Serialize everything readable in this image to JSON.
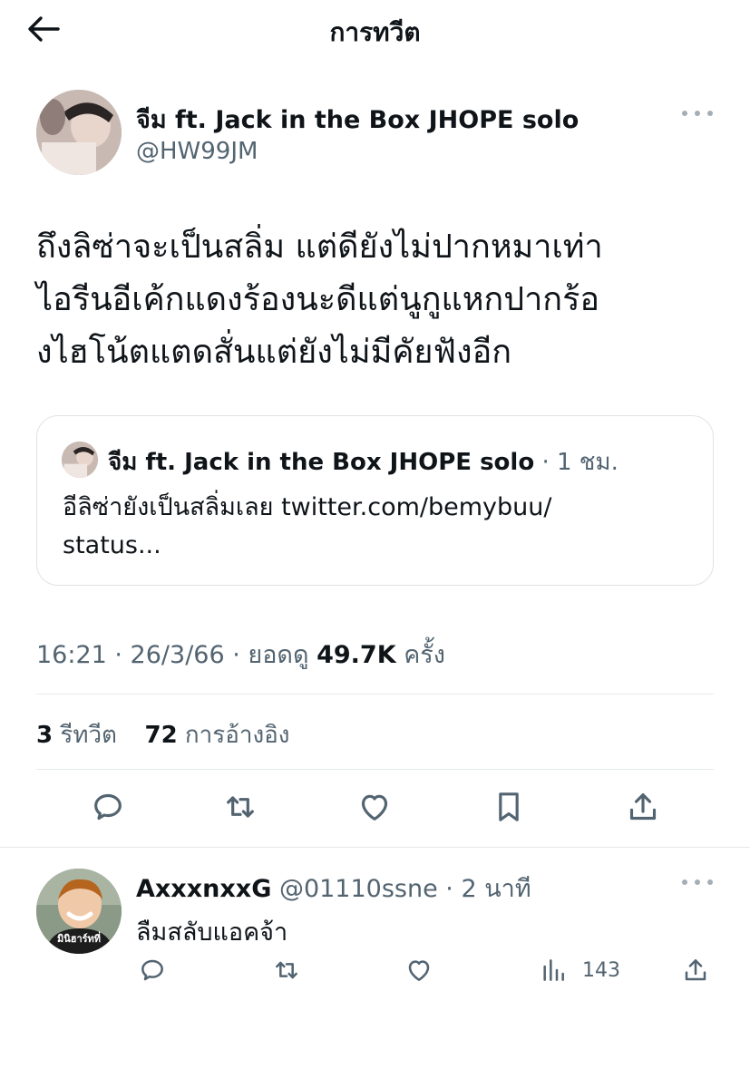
{
  "header": {
    "title": "การทวีต",
    "back_icon": "arrow-left-icon"
  },
  "tweet": {
    "author_name": "จีม ft. Jack in the Box JHOPE solo",
    "handle": "@HW99JM",
    "text_lines": [
      "ถึงลิซ่าจะเป็นสลิ่ม แต่ดียังไม่ปากหมาเท่า",
      "ไอรีนอีเค้กแดงร้องนะดีแต่นูกูแหกปากร้อ",
      "งไฮโน้ตแตดสั่นแต่ยังไม่มีคัยฟังอีก"
    ],
    "quote": {
      "author_name": "จีม ft. Jack in the Box JHOPE solo",
      "time": " · 1 ชม.",
      "text_line1": "อีลิซ่ายังเป็นสลิ่มเลย twitter.com/bemybuu/",
      "text_line2": "status..."
    },
    "timestamp": "16:21 · 26/3/66 · ยอดดู ",
    "views": "49.7K",
    "views_unit": " ครั้ง",
    "retweets": "3",
    "retweets_label": " รีทวีต",
    "quotes": "72",
    "quotes_label": " การอ้างอิง"
  },
  "reply": {
    "author_name": "AxxxnxxG",
    "meta": " @01110ssne · 2 นาที",
    "text": "ลืมสลับแอคจ้า",
    "avatar_caption": "มินิฮาร์ทที่",
    "views": "143"
  },
  "colors": {
    "text": "#0f1419",
    "secondary": "#536471",
    "border": "#dfe3e7"
  }
}
